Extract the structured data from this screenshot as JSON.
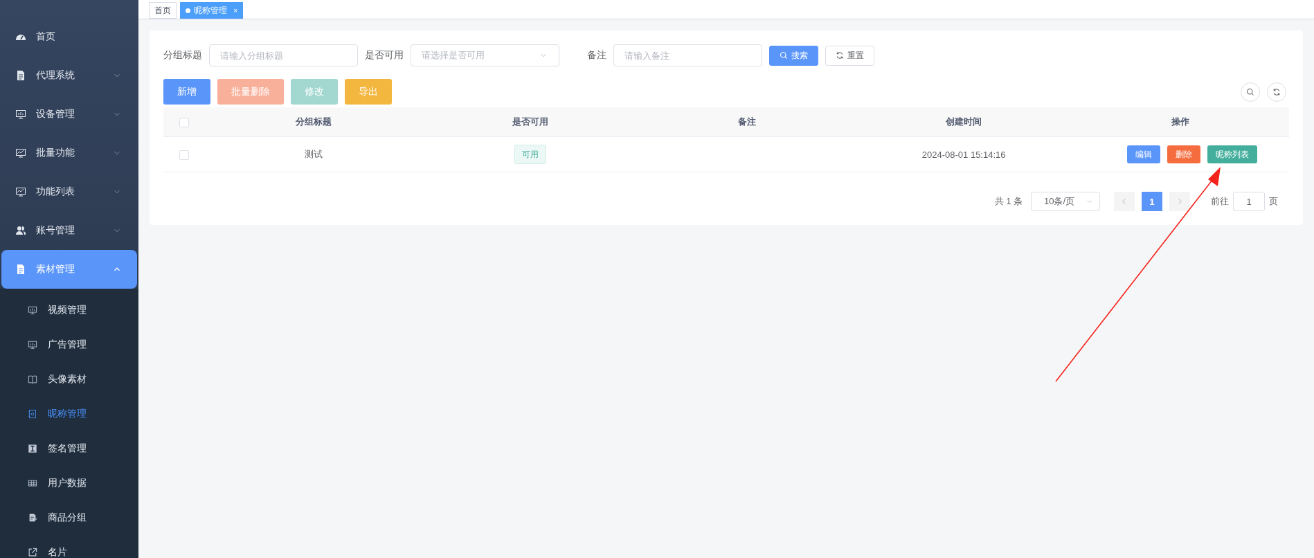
{
  "sidebar": {
    "items": [
      {
        "label": "首页",
        "selected": false
      },
      {
        "label": "代理系统",
        "expanded": false,
        "selected": false
      },
      {
        "label": "设备管理",
        "expanded": false,
        "selected": false
      },
      {
        "label": "批量功能",
        "expanded": false,
        "selected": false
      },
      {
        "label": "功能列表",
        "expanded": false,
        "selected": false
      },
      {
        "label": "账号管理",
        "expanded": false,
        "selected": false
      },
      {
        "label": "素材管理",
        "expanded": true,
        "selected": true,
        "children": [
          {
            "label": "视频管理",
            "selected": false
          },
          {
            "label": "广告管理",
            "selected": false
          },
          {
            "label": "头像素材",
            "selected": false
          },
          {
            "label": "昵称管理",
            "selected": true
          },
          {
            "label": "签名管理",
            "selected": false
          },
          {
            "label": "用户数据",
            "selected": false
          },
          {
            "label": "商品分组",
            "selected": false
          },
          {
            "label": "名片",
            "selected": false
          }
        ]
      }
    ]
  },
  "tabs": [
    {
      "label": "首页",
      "selected": false
    },
    {
      "label": "昵称管理",
      "selected": true,
      "close": "×"
    }
  ],
  "filters": [
    {
      "kind": "input",
      "label": "分组标题",
      "placeholder": "请输入分组标题"
    },
    {
      "kind": "select",
      "label": "是否可用",
      "placeholder": "请选择是否可用"
    },
    {
      "kind": "input",
      "label": "备注",
      "placeholder": "请输入备注"
    }
  ],
  "filter_buttons": [
    {
      "kind": "primary",
      "label": "搜索"
    },
    {
      "kind": "plain",
      "label": "重置"
    }
  ],
  "toolbar": [
    {
      "kind": "primary",
      "label": "新增",
      "disabled": false
    },
    {
      "kind": "danger",
      "label": "批量删除",
      "disabled": true
    },
    {
      "kind": "success",
      "label": "修改",
      "disabled": true
    },
    {
      "kind": "warning",
      "label": "导出",
      "disabled": false
    }
  ],
  "table": {
    "all_checked": false,
    "columns": [
      "分组标题",
      "是否可用",
      "备注",
      "创建时间",
      "操作"
    ],
    "rows": [
      {
        "checked": false,
        "title": "测试",
        "status": "可用",
        "created": "2024-08-01 15:14:16",
        "actions": [
          {
            "kind": "primary",
            "label": "编辑"
          },
          {
            "kind": "danger",
            "label": "删除"
          },
          {
            "kind": "success",
            "label": "昵称列表"
          }
        ]
      }
    ]
  },
  "pagination": {
    "total": "共 1 条",
    "page_size": "10条/页",
    "pages": [
      {
        "label": "1",
        "selected": true
      }
    ],
    "jump_label": "前往",
    "jump_value": "1",
    "jump_suffix": "页"
  }
}
